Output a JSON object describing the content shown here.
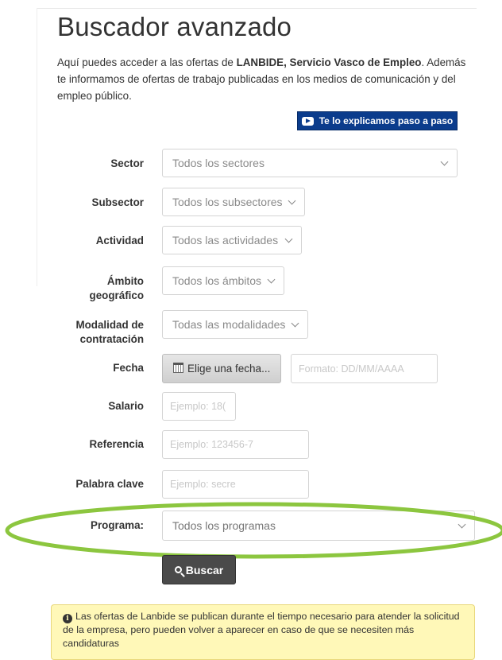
{
  "page": {
    "title": "Buscador avanzado",
    "intro_prefix": "Aquí puedes acceder a las ofertas de ",
    "intro_bold": "LANBIDE, Servicio Vasco de Empleo",
    "intro_suffix": ". Además te informamos de ofertas de trabajo publicadas en los medios de comunicación y del empleo público.",
    "video_button": "Te lo explicamos paso a paso"
  },
  "form": {
    "sector": {
      "label": "Sector",
      "value": "Todos los sectores"
    },
    "subsector": {
      "label": "Subsector",
      "value": "Todos los subsectores"
    },
    "actividad": {
      "label": "Actividad",
      "value": "Todos las actividades"
    },
    "ambito": {
      "label_line1": "Ámbito",
      "label_line2": "geográfico",
      "value": "Todos los ámbitos"
    },
    "modalidad": {
      "label_line1": "Modalidad de",
      "label_line2": "contratación",
      "value": "Todas las modalidades"
    },
    "fecha": {
      "label": "Fecha",
      "button": "Elige una fecha...",
      "placeholder": "Formato: DD/MM/AAAA"
    },
    "salario": {
      "label": "Salario",
      "placeholder": "Ejemplo: 18("
    },
    "referencia": {
      "label": "Referencia",
      "placeholder": "Ejemplo: 123456-7"
    },
    "palabra": {
      "label": "Palabra clave",
      "placeholder": "Ejemplo: secre"
    },
    "programa": {
      "label": "Programa:",
      "value": "Todos los programas"
    },
    "search_button": "Buscar"
  },
  "notice": {
    "text": "Las ofertas de Lanbide se publican durante el tiempo necesario para atender la solicitud de la empresa, pero pueden volver a aparecer en caso de que se necesiten más candidaturas"
  },
  "colors": {
    "video_button_bg": "#0b3c8c",
    "highlight_ellipse": "#8cc63f",
    "notice_bg": "#fff8b8",
    "search_button_bg": "#4a4a4a"
  },
  "icons": [
    "youtube-icon",
    "chevron-down-icon",
    "calendar-icon",
    "search-icon",
    "info-icon"
  ]
}
